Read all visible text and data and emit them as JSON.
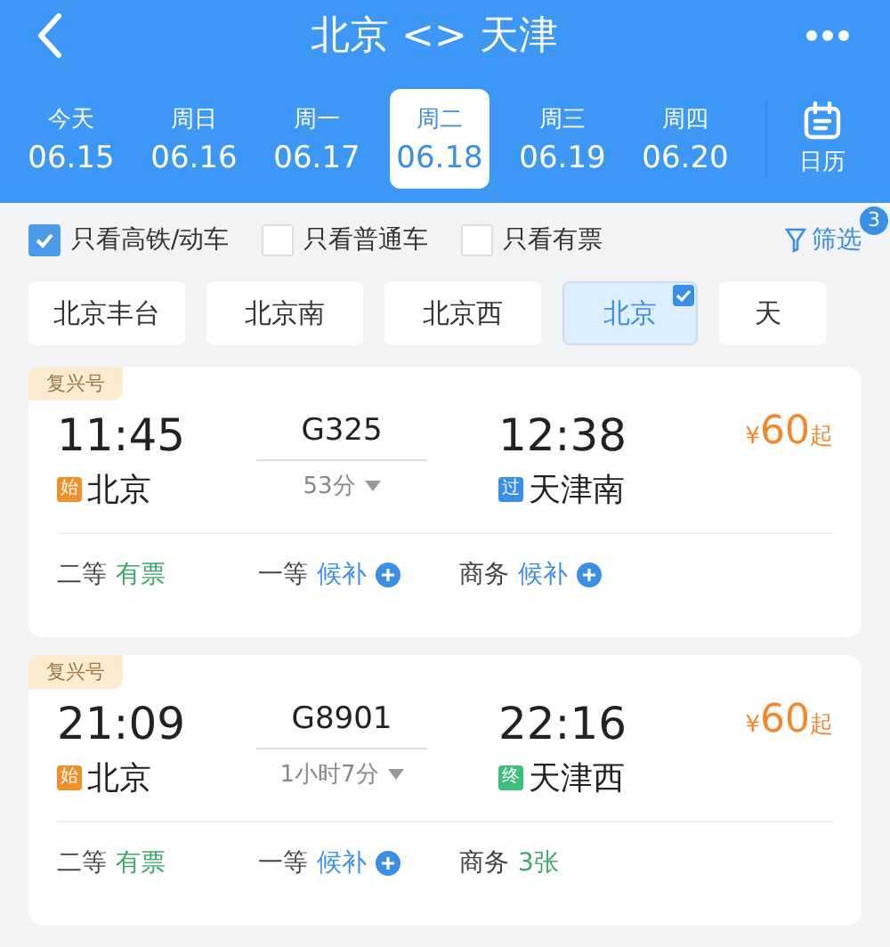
{
  "header": {
    "title": "北京 <> 天津"
  },
  "dates": [
    {
      "weekday": "今天",
      "date": "06.15",
      "selected": false
    },
    {
      "weekday": "周日",
      "date": "06.16",
      "selected": false
    },
    {
      "weekday": "周一",
      "date": "06.17",
      "selected": false
    },
    {
      "weekday": "周二",
      "date": "06.18",
      "selected": true
    },
    {
      "weekday": "周三",
      "date": "06.19",
      "selected": false
    },
    {
      "weekday": "周四",
      "date": "06.20",
      "selected": false
    }
  ],
  "calendar_label": "日历",
  "filters": [
    {
      "label": "只看高铁/动车",
      "checked": true
    },
    {
      "label": "只看普通车",
      "checked": false
    },
    {
      "label": "只看有票",
      "checked": false
    }
  ],
  "filter_button": {
    "label": "筛选",
    "badge": "3"
  },
  "stations": [
    {
      "name": "北京丰台",
      "selected": false
    },
    {
      "name": "北京南",
      "selected": false
    },
    {
      "name": "北京西",
      "selected": false
    },
    {
      "name": "北京",
      "selected": true
    },
    {
      "name": "天",
      "selected": false
    }
  ],
  "trains": [
    {
      "tag": "复兴号",
      "depart_time": "11:45",
      "train_no": "G325",
      "arrive_time": "12:38",
      "price": "60",
      "price_prefix": "¥",
      "price_suffix": "起",
      "duration": "53分",
      "from_badge": {
        "text": "始",
        "color": "#f0902a"
      },
      "from": "北京",
      "to_badge": {
        "text": "过",
        "color": "#3a8ee6"
      },
      "to": "天津南",
      "seats": [
        {
          "class": "二等",
          "status": "有票",
          "kind": "available"
        },
        {
          "class": "一等",
          "status": "候补",
          "kind": "waitlist"
        },
        {
          "class": "商务",
          "status": "候补",
          "kind": "waitlist"
        }
      ]
    },
    {
      "tag": "复兴号",
      "depart_time": "21:09",
      "train_no": "G8901",
      "arrive_time": "22:16",
      "price": "60",
      "price_prefix": "¥",
      "price_suffix": "起",
      "duration": "1小时7分",
      "from_badge": {
        "text": "始",
        "color": "#f0902a"
      },
      "from": "北京",
      "to_badge": {
        "text": "终",
        "color": "#3cbf7a"
      },
      "to": "天津西",
      "seats": [
        {
          "class": "二等",
          "status": "有票",
          "kind": "available"
        },
        {
          "class": "一等",
          "status": "候补",
          "kind": "waitlist"
        },
        {
          "class": "商务",
          "status": "3张",
          "kind": "available"
        }
      ]
    }
  ]
}
